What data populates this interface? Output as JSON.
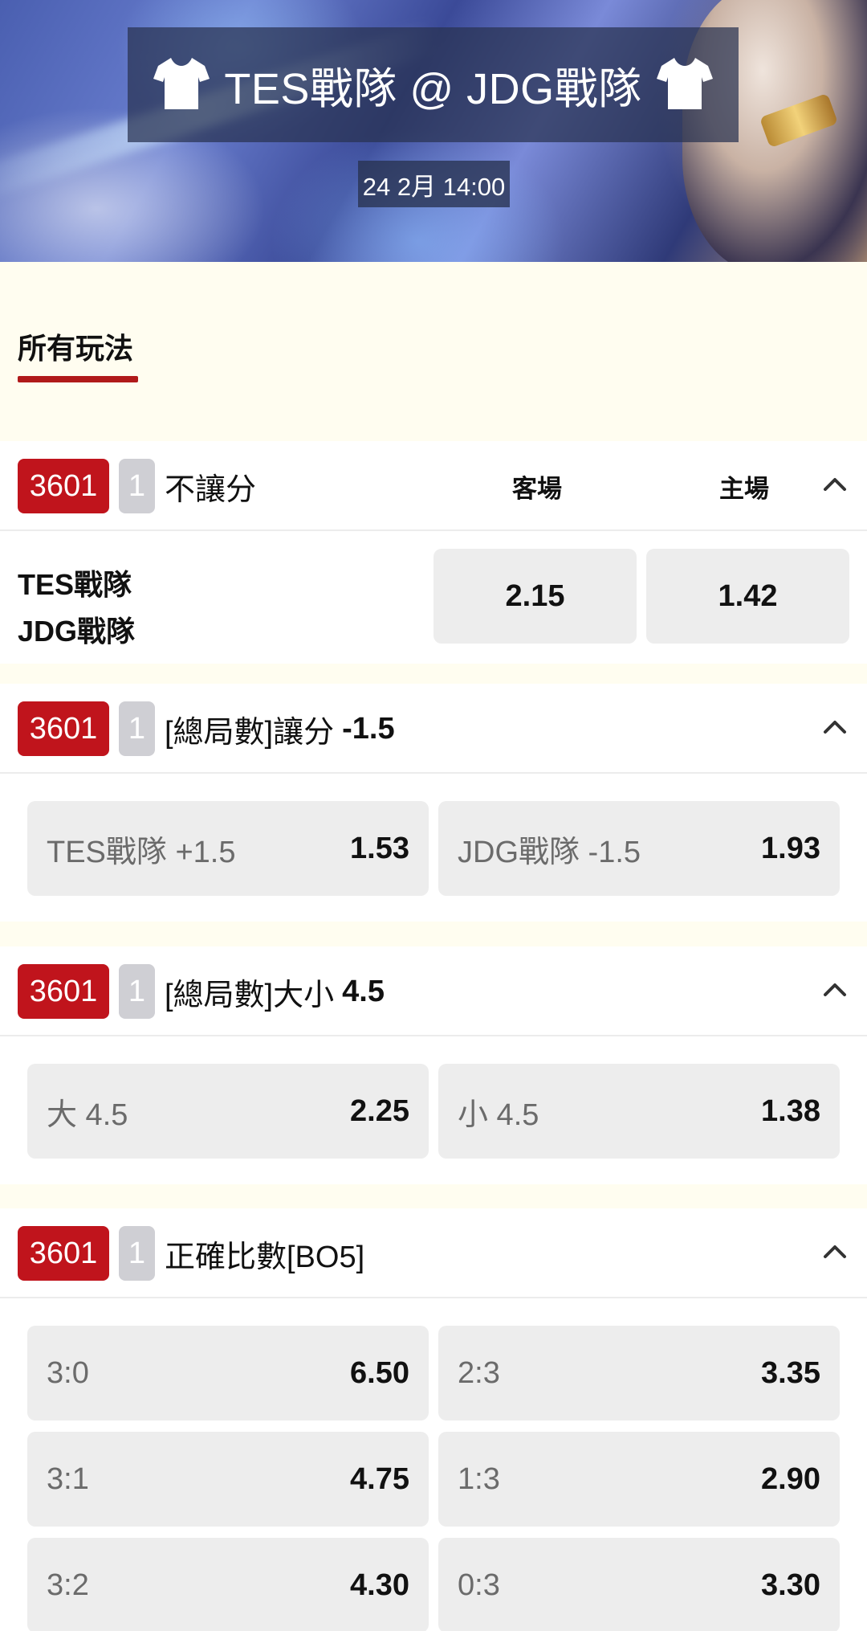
{
  "header": {
    "match_title": "TES戰隊 @ JDG戰隊",
    "datetime": "24 2月 14:00"
  },
  "tabs": [
    {
      "label": "所有玩法",
      "active": true
    }
  ],
  "colors": {
    "accent_red": "#c0141c",
    "tab_underline": "#b01a1a",
    "option_bg": "#ededed"
  },
  "markets": [
    {
      "id": "3601",
      "count": "1",
      "title": "不讓分",
      "line": "",
      "col_away": "客場",
      "col_home": "主場",
      "teams": [
        "TES戰隊",
        "JDG戰隊"
      ],
      "odds_away": "2.15",
      "odds_home": "1.42"
    },
    {
      "id": "3601",
      "count": "1",
      "title": "[總局數]讓分",
      "line": "-1.5",
      "options": [
        {
          "label": "TES戰隊 +1.5",
          "odds": "1.53"
        },
        {
          "label": "JDG戰隊 -1.5",
          "odds": "1.93"
        }
      ]
    },
    {
      "id": "3601",
      "count": "1",
      "title": "[總局數]大小",
      "line": "4.5",
      "options": [
        {
          "label": "大 4.5",
          "odds": "2.25"
        },
        {
          "label": "小 4.5",
          "odds": "1.38"
        }
      ]
    },
    {
      "id": "3601",
      "count": "1",
      "title": "正確比數[BO5]",
      "line": "",
      "options": [
        {
          "label": "3:0",
          "odds": "6.50"
        },
        {
          "label": "2:3",
          "odds": "3.35"
        },
        {
          "label": "3:1",
          "odds": "4.75"
        },
        {
          "label": "1:3",
          "odds": "2.90"
        },
        {
          "label": "3:2",
          "odds": "4.30"
        },
        {
          "label": "0:3",
          "odds": "3.30"
        }
      ]
    }
  ]
}
